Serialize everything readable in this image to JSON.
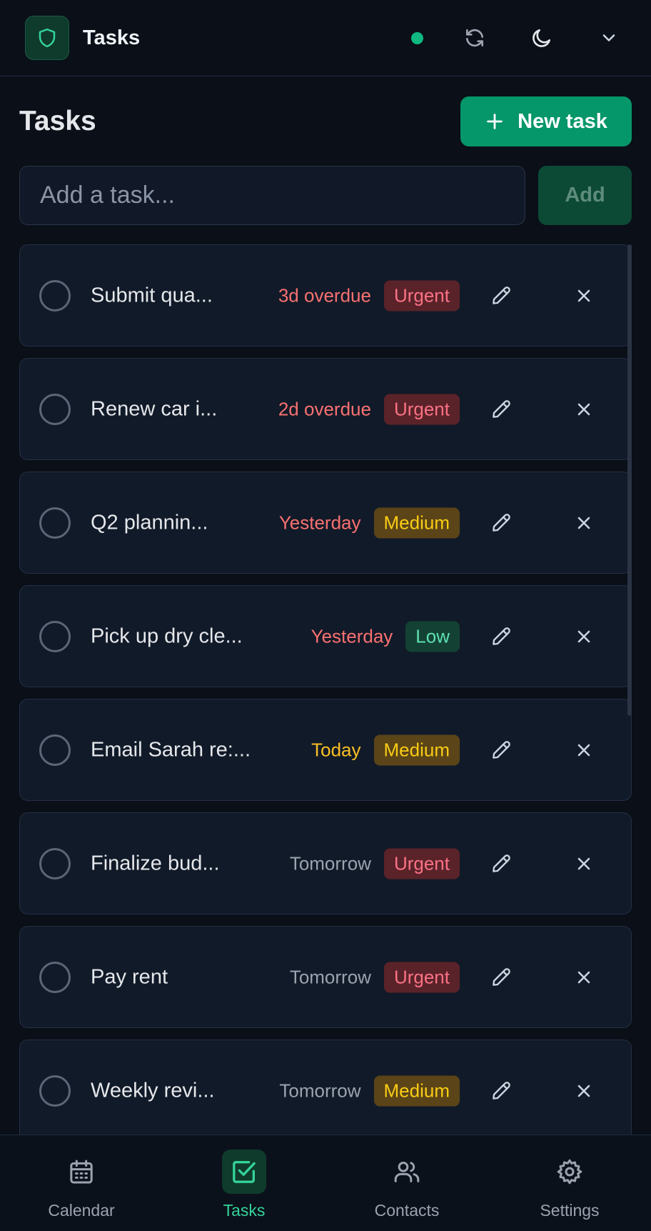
{
  "header": {
    "title": "Tasks",
    "logo_icon": "shield-icon",
    "status_color": "#10b981",
    "actions": [
      "sync-icon",
      "moon-icon",
      "chevron-down-icon"
    ]
  },
  "page": {
    "title": "Tasks",
    "new_task_label": "New task"
  },
  "add_row": {
    "placeholder": "Add a task...",
    "button_label": "Add"
  },
  "tasks": [
    {
      "title": "Submit qua...",
      "due": "3d overdue",
      "due_color": "#f87171",
      "priority": "Urgent",
      "priority_style": "urgent"
    },
    {
      "title": "Renew car i...",
      "due": "2d overdue",
      "due_color": "#f87171",
      "priority": "Urgent",
      "priority_style": "urgent"
    },
    {
      "title": "Q2 plannin...",
      "due": "Yesterday",
      "due_color": "#f87171",
      "priority": "Medium",
      "priority_style": "medium"
    },
    {
      "title": "Pick up dry cle...",
      "due": "Yesterday",
      "due_color": "#f87171",
      "priority": "Low",
      "priority_style": "low"
    },
    {
      "title": "Email Sarah re:...",
      "due": "Today",
      "due_color": "#fbbf24",
      "priority": "Medium",
      "priority_style": "medium"
    },
    {
      "title": "Finalize bud...",
      "due": "Tomorrow",
      "due_color": "#9ca3af",
      "priority": "Urgent",
      "priority_style": "urgent"
    },
    {
      "title": "Pay rent",
      "due": "Tomorrow",
      "due_color": "#9ca3af",
      "priority": "Urgent",
      "priority_style": "urgent"
    },
    {
      "title": "Weekly revi...",
      "due": "Tomorrow",
      "due_color": "#9ca3af",
      "priority": "Medium",
      "priority_style": "medium"
    }
  ],
  "nav": {
    "items": [
      {
        "label": "Calendar",
        "icon": "calendar-icon",
        "active": false
      },
      {
        "label": "Tasks",
        "icon": "checkbox-icon",
        "active": true
      },
      {
        "label": "Contacts",
        "icon": "users-icon",
        "active": false
      },
      {
        "label": "Settings",
        "icon": "gear-icon",
        "active": false
      }
    ]
  }
}
